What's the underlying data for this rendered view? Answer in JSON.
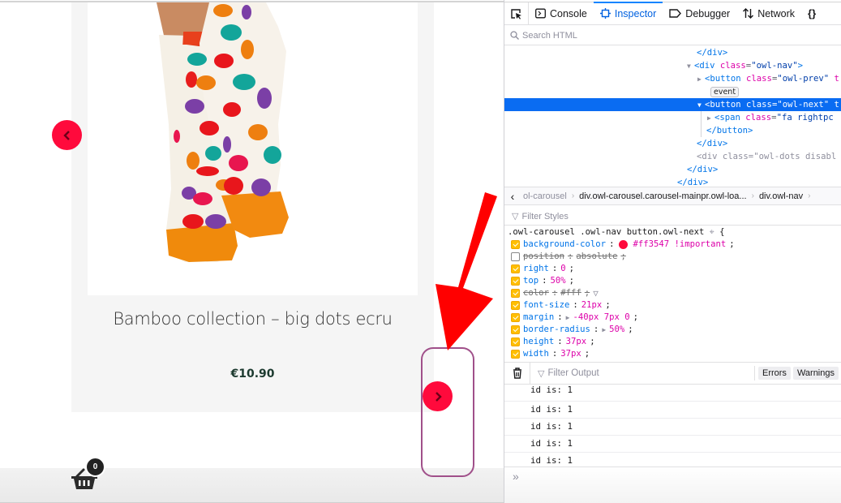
{
  "site": {
    "product": {
      "title": "Bamboo collection – big dots ecru",
      "price": "€10.90",
      "image_alt": "colorful big dots socks"
    },
    "carousel": {
      "prev_icon": "chevron-left-icon",
      "next_icon": "chevron-right-icon",
      "button_color": "#ff3547"
    },
    "cart": {
      "icon": "basket-icon",
      "count": "0"
    },
    "annotation": {
      "arrow_color": "#ff0000",
      "highlight_color": "#a0508a"
    }
  },
  "devtools": {
    "toolbar": {
      "picker_icon": "element-picker-icon",
      "tabs": [
        {
          "label": "Console",
          "icon": "console-icon",
          "active": false
        },
        {
          "label": "Inspector",
          "icon": "inspector-icon",
          "active": true
        },
        {
          "label": "Debugger",
          "icon": "debugger-icon",
          "active": false
        },
        {
          "label": "Network",
          "icon": "network-icon",
          "active": false
        },
        {
          "label": "",
          "icon": "style-editor-braces-icon",
          "active": false
        }
      ]
    },
    "search_html": {
      "placeholder": "Search HTML"
    },
    "markup": {
      "lines": [
        {
          "tag_close": "</div>"
        },
        {
          "open": "<div",
          "attr": "class",
          "value": "\"owl-nav\"",
          "end": ">"
        },
        {
          "open": "<button",
          "attr": "class",
          "value": "\"owl-prev\""
        },
        {
          "badge": "event"
        },
        {
          "open": "<button",
          "attr": "class",
          "value": "\"owl-next\"",
          "selected": true
        },
        {
          "open": "<span",
          "attr": "class",
          "value": "\"fa rightpc"
        },
        {
          "tag_close": "</button>"
        },
        {
          "tag_close": "</div>"
        },
        {
          "open": "<div",
          "attr": "class",
          "value": "\"owl-dots disabl",
          "dimmed": true
        },
        {
          "tag_close": "</div>"
        },
        {
          "tag_close": "</div>"
        }
      ]
    },
    "breadcrumbs": [
      "ol-carousel",
      "div.owl-carousel.carousel-mainpr.owl-loa...",
      "div.owl-nav"
    ],
    "filter_styles": {
      "placeholder": "Filter Styles"
    },
    "rule": {
      "selector": ".owl-carousel .owl-nav button.owl-next",
      "declarations": [
        {
          "name": "background-color",
          "value": "#ff3547 !important",
          "enabled": true,
          "swatch": "#ff0a3c"
        },
        {
          "name": "position",
          "value": "absolute",
          "enabled": false
        },
        {
          "name": "right",
          "value": "0",
          "enabled": true
        },
        {
          "name": "top",
          "value": "50%",
          "enabled": true
        },
        {
          "name": "color",
          "value": "#fff",
          "enabled": true,
          "overridden": true
        },
        {
          "name": "font-size",
          "value": "21px",
          "enabled": true
        },
        {
          "name": "margin",
          "value": "-40px 7px 0",
          "enabled": true,
          "expandable": true
        },
        {
          "name": "border-radius",
          "value": "50%",
          "enabled": true,
          "expandable": true
        },
        {
          "name": "height",
          "value": "37px",
          "enabled": true
        },
        {
          "name": "width",
          "value": "37px",
          "enabled": true
        }
      ]
    },
    "console": {
      "filter_placeholder": "Filter Output",
      "buttons": [
        "Errors",
        "Warnings"
      ],
      "logs": [
        "id is: 1",
        "id is: 1",
        "id is: 1",
        "id is: 1",
        "id is: 1"
      ],
      "prompt": "»"
    }
  }
}
